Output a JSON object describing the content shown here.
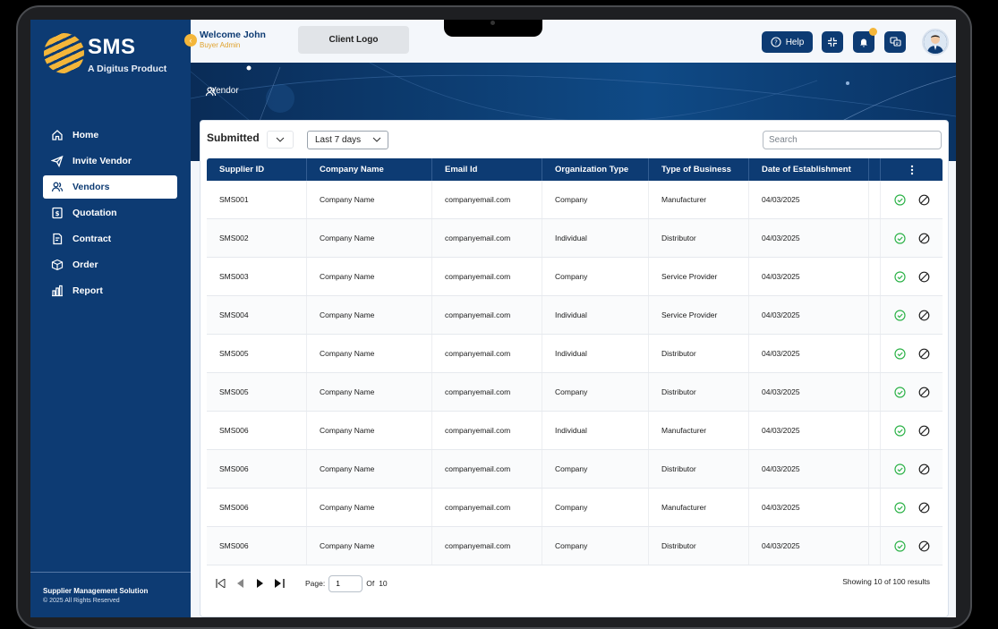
{
  "sidebar": {
    "brand": "SMS",
    "tagline": "A Digitus Product",
    "items": [
      {
        "label": "Home",
        "icon": "home-icon"
      },
      {
        "label": "Invite Vendor",
        "icon": "send-icon"
      },
      {
        "label": "Vendors",
        "icon": "users-icon",
        "active": true
      },
      {
        "label": "Quotation",
        "icon": "quotation-icon"
      },
      {
        "label": "Contract",
        "icon": "contract-icon"
      },
      {
        "label": "Order",
        "icon": "box-icon"
      },
      {
        "label": "Report",
        "icon": "bar-chart-icon"
      }
    ],
    "footer_title": "Supplier Management Solution",
    "footer_copy": "© 2025 All Rights Reserved"
  },
  "header": {
    "welcome": "Welcome John",
    "role": "Buyer Admin",
    "client_logo": "Client Logo",
    "help_label": "Help"
  },
  "breadcrumb": "Vendor",
  "filters": {
    "status": "Submitted",
    "range": "Last 7 days",
    "search_placeholder": "Search"
  },
  "table": {
    "columns": [
      "Supplier ID",
      "Company Name",
      "Email Id",
      "Organization Type",
      "Type of Business",
      "Date of Establishment"
    ],
    "rows": [
      [
        "SMS001",
        "Company Name",
        "companyemail.com",
        "Company",
        "Manufacturer",
        "04/03/2025"
      ],
      [
        "SMS002",
        "Company Name",
        "companyemail.com",
        "Individual",
        "Distributor",
        "04/03/2025"
      ],
      [
        "SMS003",
        "Company Name",
        "companyemail.com",
        "Company",
        "Service Provider",
        "04/03/2025"
      ],
      [
        "SMS004",
        "Company Name",
        "companyemail.com",
        "Individual",
        "Service Provider",
        "04/03/2025"
      ],
      [
        "SMS005",
        "Company Name",
        "companyemail.com",
        "Individual",
        "Distributor",
        "04/03/2025"
      ],
      [
        "SMS005",
        "Company Name",
        "companyemail.com",
        "Company",
        "Distributor",
        "04/03/2025"
      ],
      [
        "SMS006",
        "Company Name",
        "companyemail.com",
        "Individual",
        "Manufacturer",
        "04/03/2025"
      ],
      [
        "SMS006",
        "Company Name",
        "companyemail.com",
        "Company",
        "Distributor",
        "04/03/2025"
      ],
      [
        "SMS006",
        "Company Name",
        "companyemail.com",
        "Company",
        "Manufacturer",
        "04/03/2025"
      ],
      [
        "SMS006",
        "Company Name",
        "companyemail.com",
        "Company",
        "Distributor",
        "04/03/2025"
      ]
    ]
  },
  "pager": {
    "page_label": "Page:",
    "page_value": "1",
    "of_label": "Of",
    "total_pages": "10",
    "results": "Showing 10 of 100 results"
  },
  "colors": {
    "primary": "#0d3b73",
    "accent": "#f4b63a",
    "approve": "#2fb34a"
  }
}
